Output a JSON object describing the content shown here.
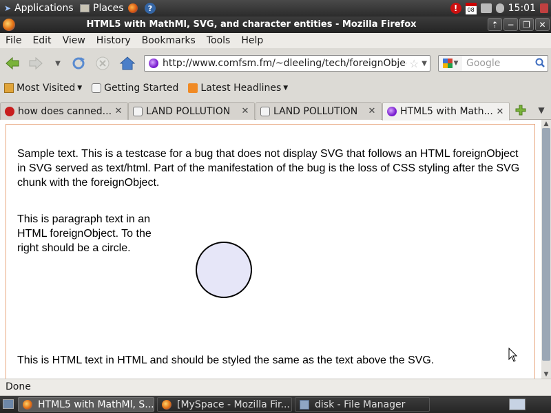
{
  "top_panel": {
    "applications": "Applications",
    "places": "Places",
    "alert_glyph": "!",
    "calendar_day": "08",
    "clock": "15:01",
    "help_glyph": "?"
  },
  "window": {
    "title": "HTML5 with MathMl, SVG, and character entities - Mozilla Firefox",
    "buttons": {
      "up": "⇡",
      "minimize": "−",
      "maximize": "❐",
      "close": "✕"
    }
  },
  "menu": [
    "File",
    "Edit",
    "View",
    "History",
    "Bookmarks",
    "Tools",
    "Help"
  ],
  "navigation": {
    "url": "http://www.comfsm.fm/~dleeling/tech/foreignObject.h",
    "search_placeholder": "Google"
  },
  "bookmarks": [
    "Most Visited",
    "Getting Started",
    "Latest Headlines"
  ],
  "tabs": [
    {
      "label": "how does canned...",
      "close": "✕"
    },
    {
      "label": "LAND POLLUTION",
      "close": "✕"
    },
    {
      "label": "LAND POLLUTION",
      "close": "✕"
    },
    {
      "label": "HTML5 with Math...",
      "close": "✕"
    }
  ],
  "page": {
    "intro_text": "Sample text. This is a testcase for a bug that does not display SVG that follows an HTML foreignObject in SVG served as text/html. Part of the manifestation of the bug is the loss of CSS styling after the SVG chunk with the foreignObject.",
    "foreign_text": "This is paragraph text in an HTML foreignObject. To the right should be a circle.",
    "footer_text": "This is HTML text in HTML and should be styled the same as the text above the SVG.",
    "circle_fill": "#e6e6f8"
  },
  "status": "Done",
  "taskbar": [
    {
      "label": "HTML5 with MathMl, S...",
      "active": true
    },
    {
      "label": "[MySpace - Mozilla Fir...",
      "active": false
    },
    {
      "label": "disk - File Manager",
      "active": false
    }
  ]
}
